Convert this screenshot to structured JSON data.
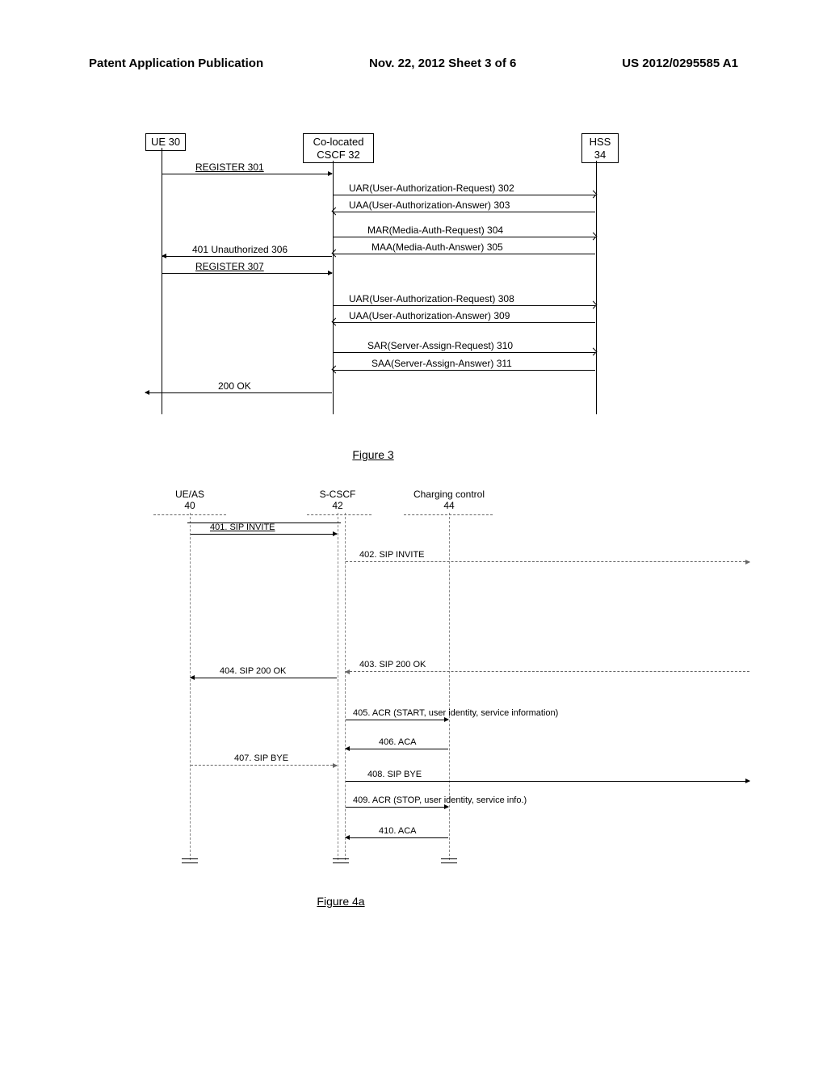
{
  "header": {
    "left": "Patent Application Publication",
    "center": "Nov. 22, 2012  Sheet 3 of 6",
    "right": "US 2012/0295585 A1"
  },
  "figure3": {
    "caption": "Figure 3",
    "actors": {
      "ue": "UE 30",
      "cscf_line1": "Co-located",
      "cscf_line2": "CSCF  32",
      "hss_line1": "HSS",
      "hss_line2": "34"
    },
    "messages": {
      "m301": "REGISTER  301",
      "m302": "UAR(User-Authorization-Request)  302",
      "m303": "UAA(User-Authorization-Answer)  303",
      "m304": "MAR(Media-Auth-Request)  304",
      "m305": "MAA(Media-Auth-Answer)  305",
      "m306": "401 Unauthorized  306",
      "m307": "REGISTER  307",
      "m308": "UAR(User-Authorization-Request)  308",
      "m309": "UAA(User-Authorization-Answer)  309",
      "m310": "SAR(Server-Assign-Request)  310",
      "m311": "SAA(Server-Assign-Answer)  311",
      "m200ok": "200 OK"
    }
  },
  "figure4a": {
    "caption": "Figure 4a",
    "actors": {
      "ueas_line1": "UE/AS",
      "ueas_line2": "40",
      "scscf_line1": "S-CSCF",
      "scscf_line2": "42",
      "charging_line1": "Charging control",
      "charging_line2": "44"
    },
    "messages": {
      "m401": "401. SIP INVITE",
      "m402": "402. SIP INVITE",
      "m403": "403. SIP 200 OK",
      "m404": "404. SIP 200 OK",
      "m405": "405. ACR (START, user identity, service information)",
      "m406": "406. ACA",
      "m407": "407. SIP BYE",
      "m408": "408. SIP BYE",
      "m409": "409. ACR (STOP, user identity, service info.)",
      "m410": "410. ACA"
    }
  }
}
